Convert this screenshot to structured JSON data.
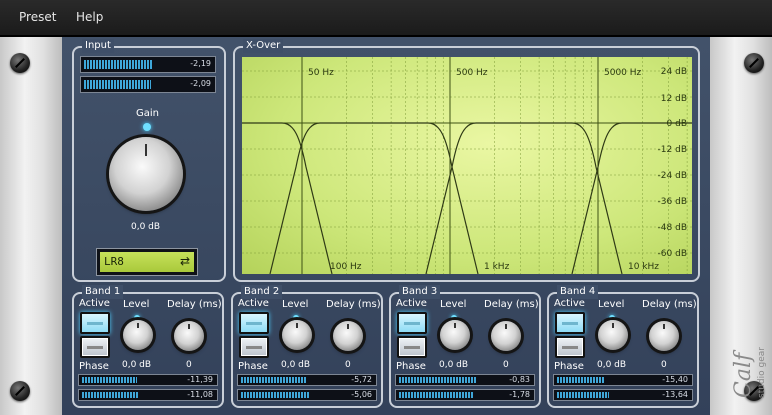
{
  "menu": {
    "items": [
      "Preset",
      "Help"
    ]
  },
  "input": {
    "title": "Input",
    "meters": [
      "-2,19",
      "-2,09"
    ],
    "meter_levels": [
      0.72,
      0.7
    ],
    "gain_label": "Gain",
    "gain_value": "0,0 dB",
    "filter_type": "LR8"
  },
  "xover": {
    "title": "X-Over",
    "freq_top": [
      "50 Hz",
      "500 Hz",
      "5000 Hz"
    ],
    "freq_bottom": [
      "100 Hz",
      "1 kHz",
      "10 kHz"
    ],
    "db_labels": [
      "24 dB",
      "12 dB",
      "0 dB",
      "-12 dB",
      "-24 dB",
      "-36 dB",
      "-48 dB",
      "-60 dB"
    ]
  },
  "band_labels": {
    "active": "Active",
    "phase": "Phase",
    "level": "Level",
    "delay": "Delay (ms)"
  },
  "bands": [
    {
      "title": "Band 1",
      "level": "0,0 dB",
      "delay": "0",
      "meters": [
        "-11,39",
        "-11,08"
      ],
      "levels": [
        0.55,
        0.56
      ]
    },
    {
      "title": "Band 2",
      "level": "0,0 dB",
      "delay": "0",
      "meters": [
        "-5,72",
        "-5,06"
      ],
      "levels": [
        0.66,
        0.68
      ]
    },
    {
      "title": "Band 3",
      "level": "0,0 dB",
      "delay": "0",
      "meters": [
        "-0,83",
        "-1,78"
      ],
      "levels": [
        0.78,
        0.75
      ]
    },
    {
      "title": "Band 4",
      "level": "0,0 dB",
      "delay": "0",
      "meters": [
        "-15,40",
        "-13,64"
      ],
      "levels": [
        0.48,
        0.52
      ]
    }
  ],
  "colors": {
    "panel": "#394860",
    "meter_blue": "#3fa7d9",
    "lcd": "#b6d446",
    "active_button": "#8fdcf5"
  },
  "brand": {
    "text": "Calf studio gear"
  }
}
